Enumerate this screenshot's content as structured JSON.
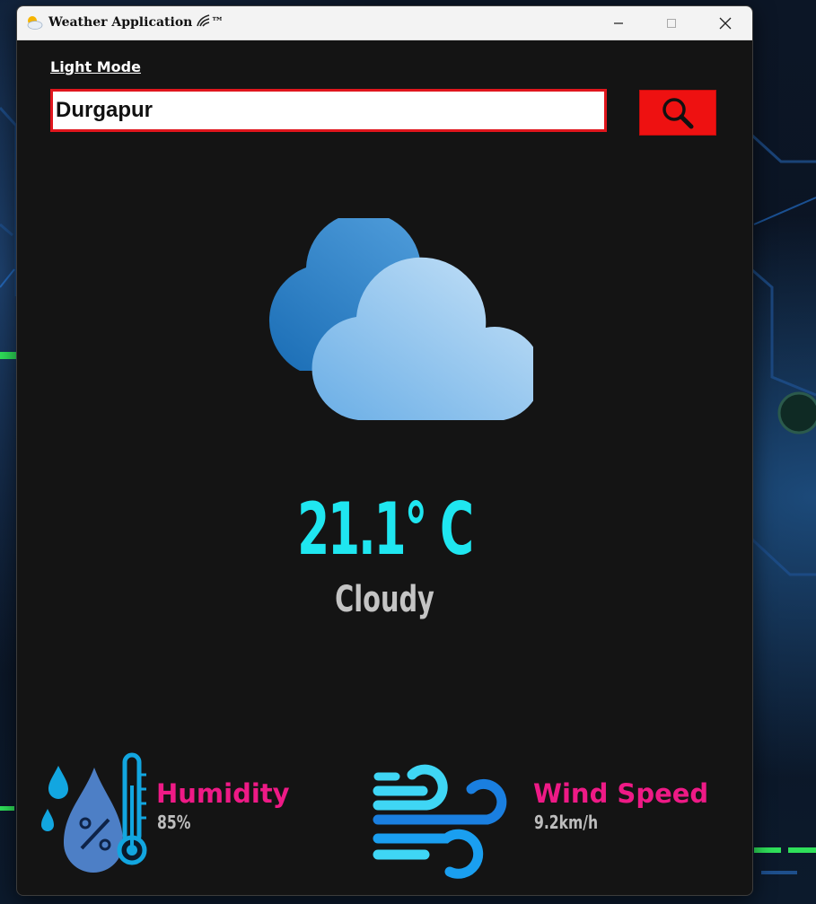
{
  "window": {
    "title": "Weather Application",
    "title_mark": "™",
    "controls": {
      "minimize": "—",
      "maximize": "☐",
      "close": "✕"
    }
  },
  "mode_toggle": {
    "label": "Light Mode"
  },
  "search": {
    "value": "Durgapur",
    "placeholder": ""
  },
  "weather": {
    "icon": "cloudy-icon",
    "temperature": "21.1° C",
    "condition": "Cloudy"
  },
  "stats": {
    "humidity": {
      "title": "Humidity",
      "value": "85%",
      "icon": "humidity-icon"
    },
    "wind": {
      "title": "Wind Speed",
      "value": "9.2km/h",
      "icon": "wind-icon"
    }
  },
  "colors": {
    "accent_red": "#ee1111",
    "temperature": "#1fe6f0",
    "stat_title": "#ee1a86",
    "window_bg": "#141414"
  }
}
